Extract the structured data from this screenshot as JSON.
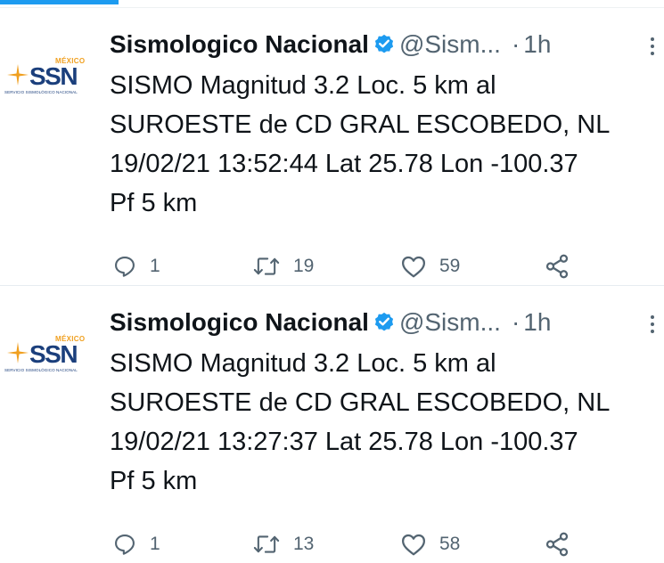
{
  "colors": {
    "accent": "#1d9bf0",
    "secondary_text": "#536471",
    "logo_blue": "#1b3f7c",
    "logo_orange": "#f0a020"
  },
  "tweets": [
    {
      "avatar": {
        "top_text": "MÉXICO",
        "main_text": "SSN",
        "sub_text": "SERVICIO SISMOLÓGICO NACIONAL"
      },
      "name": "Sismologico Nacional",
      "handle": "@Sism...",
      "separator": "·",
      "time": "1h",
      "text": "SISMO Magnitud 3.2 Loc. 5 km al\nSUROESTE de CD GRAL ESCOBEDO, NL\n19/02/21 13:52:44 Lat 25.78 Lon -100.37\nPf 5 km",
      "replies": "1",
      "retweets": "19",
      "likes": "59",
      "icons": [
        "verified-icon",
        "more-icon",
        "reply-icon",
        "retweet-icon",
        "like-icon",
        "share-icon"
      ]
    },
    {
      "avatar": {
        "top_text": "MÉXICO",
        "main_text": "SSN",
        "sub_text": "SERVICIO SISMOLÓGICO NACIONAL"
      },
      "name": "Sismologico Nacional",
      "handle": "@Sism...",
      "separator": "·",
      "time": "1h",
      "text": "SISMO Magnitud 3.2 Loc. 5 km al\nSUROESTE de CD GRAL ESCOBEDO, NL\n19/02/21 13:27:37 Lat 25.78 Lon -100.37\nPf 5 km",
      "replies": "1",
      "retweets": "13",
      "likes": "58",
      "icons": [
        "verified-icon",
        "more-icon",
        "reply-icon",
        "retweet-icon",
        "like-icon",
        "share-icon"
      ]
    }
  ]
}
